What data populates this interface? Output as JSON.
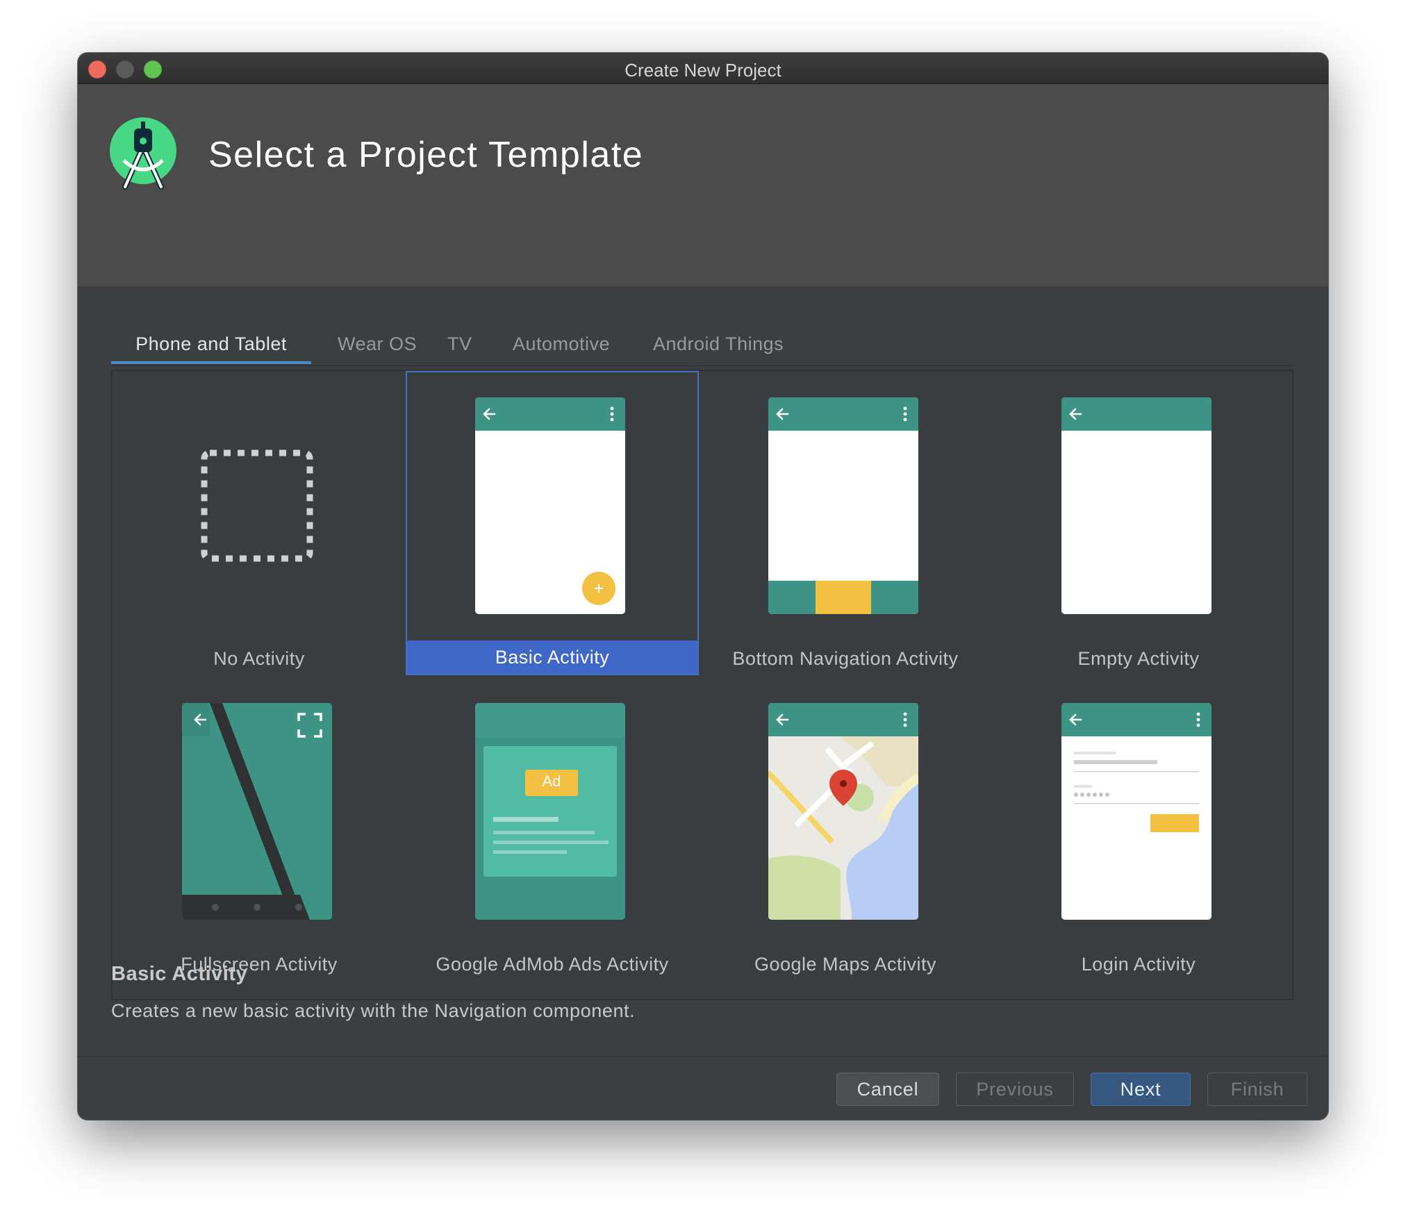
{
  "window": {
    "title": "Create New Project"
  },
  "header": {
    "title": "Select a Project Template",
    "logo_icon": "android-studio-logo-icon"
  },
  "tabs": [
    {
      "label": "Phone and Tablet",
      "active": true
    },
    {
      "label": "Wear OS",
      "active": false
    },
    {
      "label": "TV",
      "active": false
    },
    {
      "label": "Automotive",
      "active": false
    },
    {
      "label": "Android Things",
      "active": false
    }
  ],
  "templates": [
    {
      "label": "No Activity",
      "selected": false
    },
    {
      "label": "Basic Activity",
      "selected": true
    },
    {
      "label": "Bottom Navigation Activity",
      "selected": false
    },
    {
      "label": "Empty Activity",
      "selected": false
    },
    {
      "label": "Fullscreen Activity",
      "selected": false
    },
    {
      "label": "Google AdMob Ads Activity",
      "selected": false,
      "ad_badge": "Ad"
    },
    {
      "label": "Google Maps Activity",
      "selected": false
    },
    {
      "label": "Login Activity",
      "selected": false
    }
  ],
  "description": {
    "title": "Basic Activity",
    "text": "Creates a new basic activity with the Navigation component."
  },
  "buttons": {
    "cancel": "Cancel",
    "previous": "Previous",
    "next": "Next",
    "finish": "Finish"
  },
  "colors": {
    "accent_selected": "#3e67c8",
    "teal_appbar": "#3d9485",
    "fab_yellow": "#f4c042"
  }
}
